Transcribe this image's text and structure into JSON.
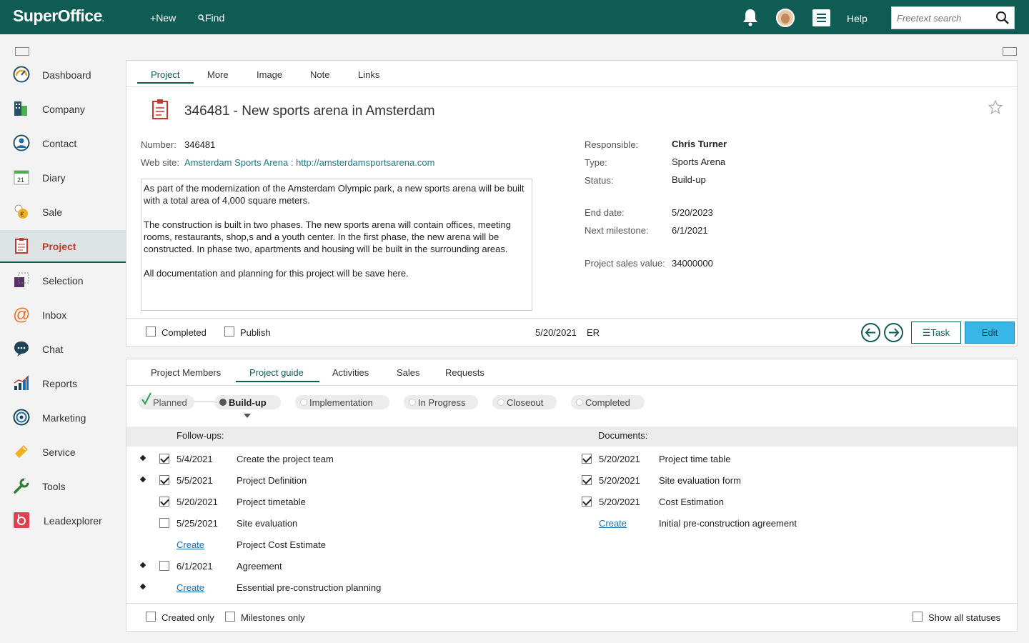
{
  "topbar": {
    "logo": "SuperOffice",
    "new_label": "New",
    "find_label": "Find",
    "help_label": "Help",
    "search_placeholder": "Freetext search"
  },
  "sidebar": {
    "items": [
      {
        "label": "Dashboard",
        "icon": "dashboard-icon"
      },
      {
        "label": "Company",
        "icon": "company-icon"
      },
      {
        "label": "Contact",
        "icon": "contact-icon"
      },
      {
        "label": "Diary",
        "icon": "diary-icon"
      },
      {
        "label": "Sale",
        "icon": "sale-icon"
      },
      {
        "label": "Project",
        "icon": "project-icon"
      },
      {
        "label": "Selection",
        "icon": "selection-icon"
      },
      {
        "label": "Inbox",
        "icon": "inbox-icon"
      },
      {
        "label": "Chat",
        "icon": "chat-icon"
      },
      {
        "label": "Reports",
        "icon": "reports-icon"
      },
      {
        "label": "Marketing",
        "icon": "marketing-icon"
      },
      {
        "label": "Service",
        "icon": "service-icon"
      },
      {
        "label": "Tools",
        "icon": "tools-icon"
      },
      {
        "label": "Leadexplorer",
        "icon": "leadexplorer-icon"
      }
    ],
    "active": "Project"
  },
  "card": {
    "tabs": [
      "Project",
      "More",
      "Image",
      "Note",
      "Links"
    ],
    "active_tab": "Project",
    "title": "346481 - New sports arena in Amsterdam",
    "number_label": "Number:",
    "number_value": "346481",
    "website_label": "Web site:",
    "website_value": "Amsterdam Sports Arena : http://amsterdamsportsarena.com",
    "description": [
      "As part of the modernization of the Amsterdam Olympic park, a new sports arena will be built with a total area of 4,000 square meters.",
      "The construction is built in two phases. The new sports arena will contain offices, meeting rooms, restaurants, shop,s and a youth center. In the first phase, the new arena will be constructed. In phase two, apartments and housing will be built in the surrounding areas.",
      "All documentation and planning for this project will be save here."
    ],
    "responsible_label": "Responsible:",
    "responsible_value": "Chris Turner",
    "type_label": "Type:",
    "type_value": "Sports Arena",
    "status_label": "Status:",
    "status_value": "Build-up",
    "enddate_label": "End date:",
    "enddate_value": "5/20/2023",
    "milestone_label": "Next milestone:",
    "milestone_value": "6/1/2021",
    "salesvalue_label": "Project sales value:",
    "salesvalue_value": "34000000",
    "completed_label": "Completed",
    "publish_label": "Publish",
    "footer_date": "5/20/2021",
    "footer_initials": "ER",
    "task_label": "Task",
    "edit_label": "Edit"
  },
  "guide": {
    "tabs": [
      "Project Members",
      "Project guide",
      "Activities",
      "Sales",
      "Requests"
    ],
    "active_tab": "Project guide",
    "stages": [
      "Planned",
      "Build-up",
      "Implementation",
      "In Progress",
      "Closeout",
      "Completed"
    ],
    "current_stage": "Build-up",
    "followups_label": "Follow-ups:",
    "documents_label": "Documents:",
    "followups": [
      {
        "milestone": true,
        "checked": true,
        "date": "5/4/2021",
        "text": "Create the project team"
      },
      {
        "milestone": true,
        "checked": true,
        "date": "5/5/2021",
        "text": "Project Definition"
      },
      {
        "milestone": false,
        "checked": true,
        "date": "5/20/2021",
        "text": "Project timetable"
      },
      {
        "milestone": false,
        "checked": false,
        "date": "5/25/2021",
        "text": "Site evaluation"
      },
      {
        "milestone": false,
        "create": "Create",
        "text": "Project Cost Estimate"
      },
      {
        "milestone": true,
        "checked": false,
        "date": "6/1/2021",
        "text": "Agreement"
      },
      {
        "milestone": true,
        "create": "Create",
        "text": "Essential pre-construction planning"
      }
    ],
    "documents": [
      {
        "checked": true,
        "date": "5/20/2021",
        "text": "Project time table"
      },
      {
        "checked": true,
        "date": "5/20/2021",
        "text": "Site evaluation form"
      },
      {
        "checked": true,
        "date": "5/20/2021",
        "text": "Cost Estimation"
      },
      {
        "create": "Create",
        "text": "Initial pre-construction agreement"
      }
    ],
    "created_only_label": "Created only",
    "milestones_only_label": "Milestones only",
    "show_all_label": "Show all statuses"
  }
}
